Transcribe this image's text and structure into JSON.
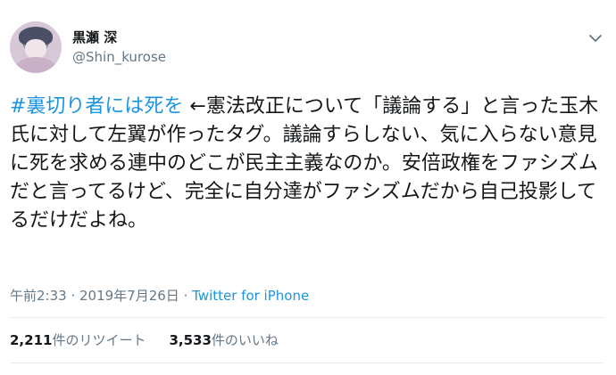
{
  "user": {
    "display_name": "黒瀬 深",
    "handle": "@Shin_kurose"
  },
  "tweet": {
    "hashtag": "#裏切り者には死を",
    "text": " ←憲法改正について「議論する」と言った玉木氏に対して左翼が作ったタグ。議論すらしない、気に入らない意見に死を求める連中のどこが民主主義なのか。安倍政権をファシズムだと言ってるけど、完全に自分達がファシズムだから自己投影してるだけだよね。",
    "time": "午前2:33",
    "separator": " · ",
    "date": "2019年7月26日",
    "source": "Twitter for iPhone"
  },
  "stats": {
    "retweets_count": "2,211",
    "retweets_label": "件のリツイート",
    "likes_count": "3,533",
    "likes_label": "件のいいね"
  },
  "icons": {
    "menu": "chevron-down-icon",
    "avatar": "profile-avatar"
  },
  "colors": {
    "link": "#1b95e0",
    "secondary": "#657786",
    "text": "#14171a"
  }
}
